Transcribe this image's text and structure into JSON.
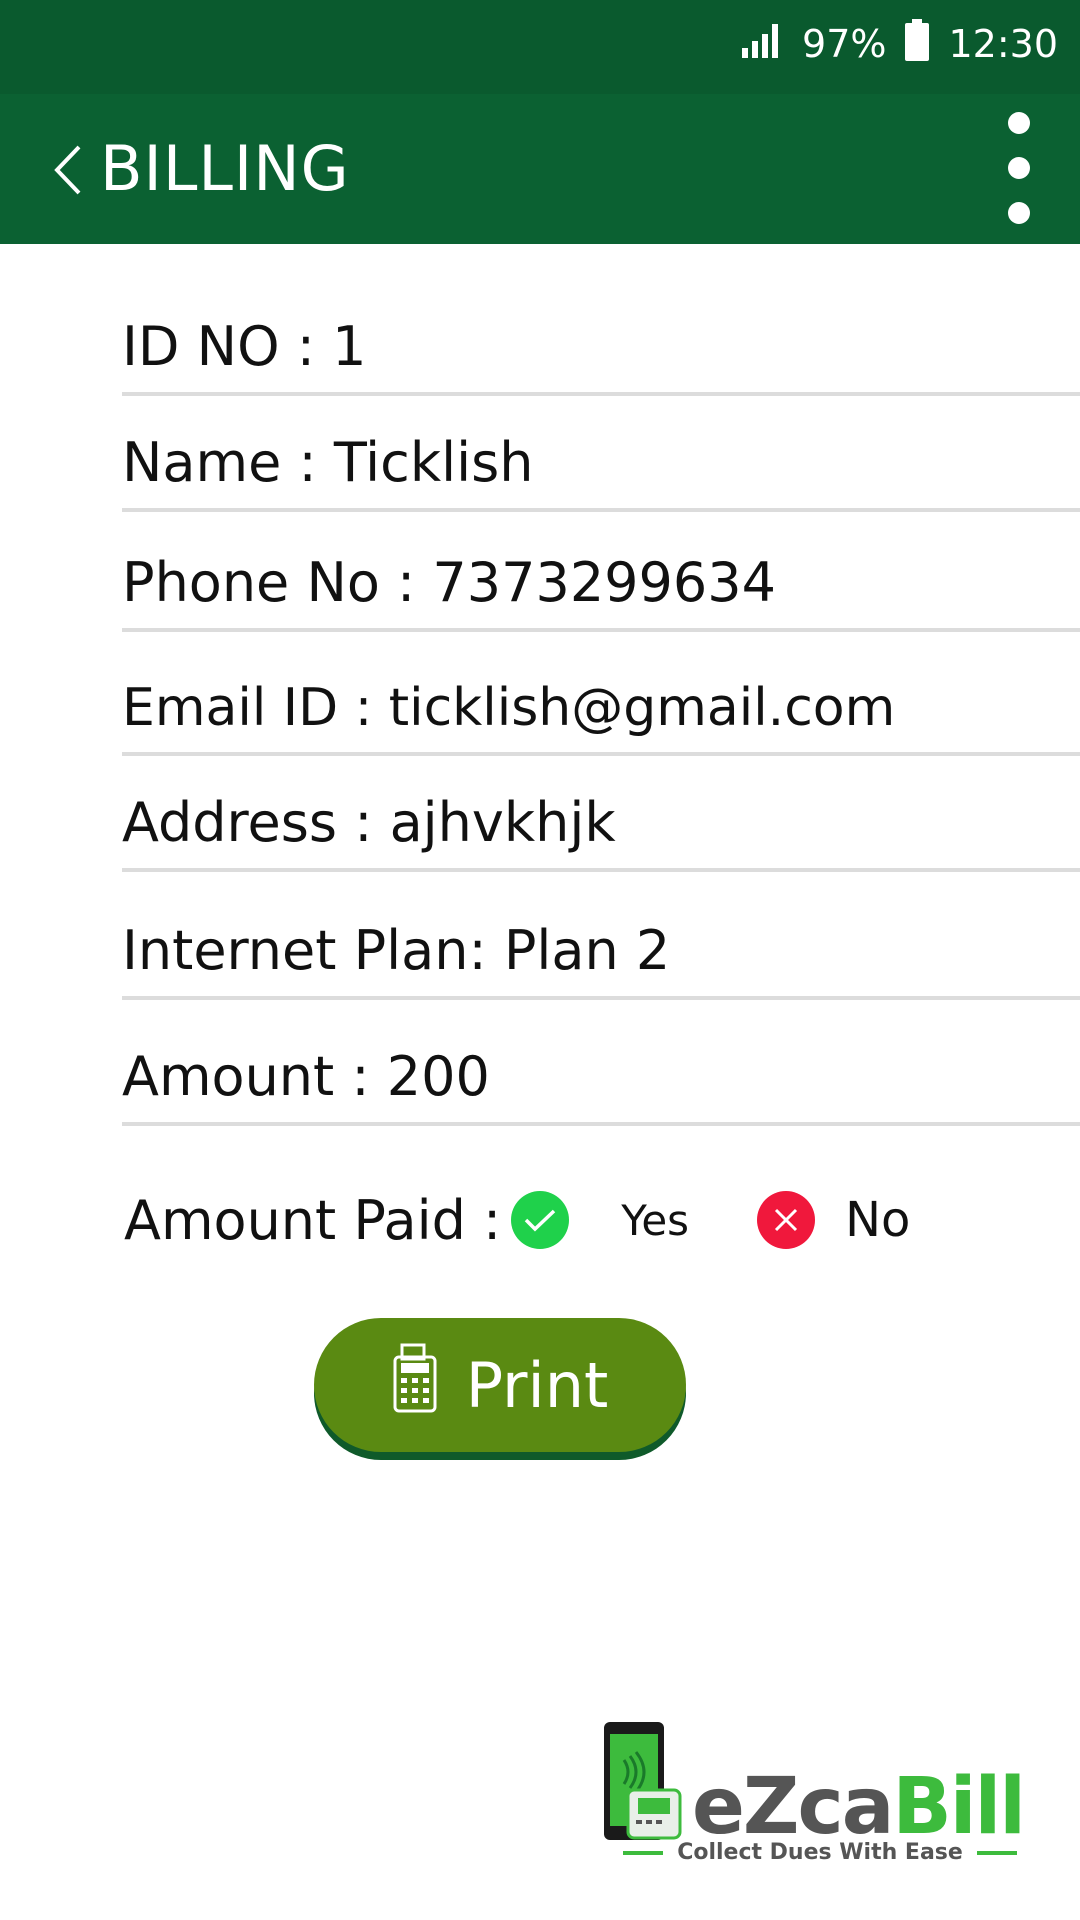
{
  "status": {
    "battery": "97%",
    "time": "12:30"
  },
  "appbar": {
    "title": "BILLING"
  },
  "fields": {
    "id": "ID NO : 1",
    "name": "Name : Ticklish",
    "phone": "Phone No : 7373299634",
    "email": "Email ID : ticklish@gmail.com",
    "address": "Address : ajhvkhjk",
    "plan": "Internet Plan: Plan 2",
    "amount": "Amount : 200"
  },
  "amount_paid": {
    "label": "Amount Paid :",
    "yes": "Yes",
    "no": "No"
  },
  "print_button": {
    "label": "Print"
  },
  "logo": {
    "name_part1": "eZca",
    "name_part2": "Bill",
    "tagline": "Collect Dues With Ease"
  },
  "colors": {
    "appbar": "#0b6132",
    "statusbar": "#0a5a2e",
    "print": "#5a8a12",
    "yes": "#1fd14b",
    "no": "#f0183c"
  },
  "icons": [
    "signal-icon",
    "battery-icon",
    "back-chevron-icon",
    "more-vert-icon",
    "check-icon",
    "close-icon",
    "calculator-icon",
    "phone-card-reader-icon"
  ]
}
